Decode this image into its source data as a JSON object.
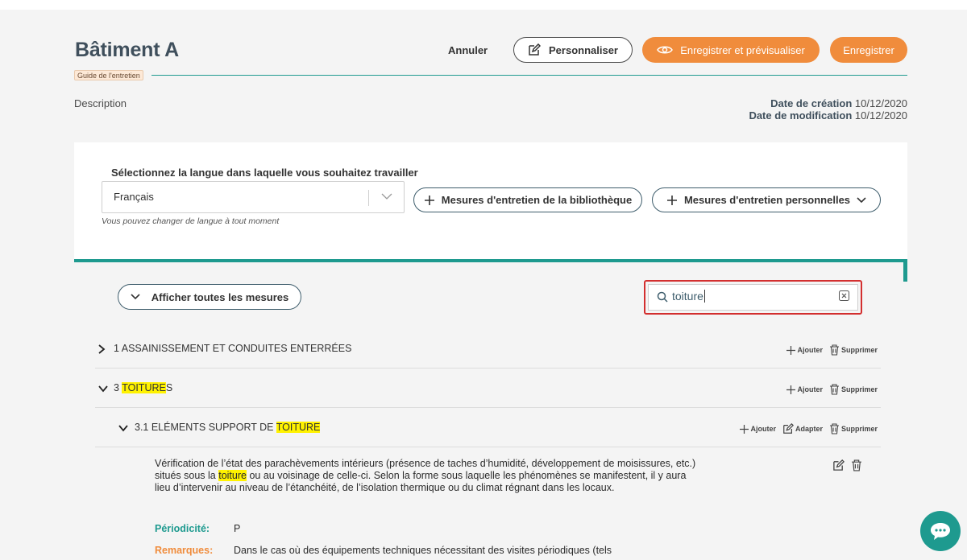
{
  "header": {
    "title": "Bâtiment A",
    "badge": "Guide de l'entretien",
    "description": "Description",
    "created_label": "Date de création",
    "created_value": "10/12/2020",
    "modified_label": "Date de modification",
    "modified_value": "10/12/2020"
  },
  "toolbar": {
    "cancel": "Annuler",
    "customize": "Personnaliser",
    "save_preview": "Enregistrer et prévisualiser",
    "save": "Enregistrer"
  },
  "language": {
    "label": "Sélectionnez la langue dans laquelle vous souhaitez travailler",
    "selected": "Français",
    "hint": "Vous pouvez changer de langue à tout moment"
  },
  "buttons": {
    "library": "Mesures d'entretien de la bibliothèque",
    "personal": "Mesures d'entretien personnelles",
    "show_all": "Afficher toutes les mesures"
  },
  "search": {
    "value": "toiture"
  },
  "actions": {
    "add": "Ajouter",
    "adapt": "Adapter",
    "delete": "Supprimer"
  },
  "rows": [
    {
      "label": "1 ASSAINISSEMENT ET CONDUITES ENTERRÉES"
    },
    {
      "prefix": "3 ",
      "highlight": "TOITURE",
      "suffix": "S"
    },
    {
      "prefix": "3.1 ELÉMENTS SUPPORT DE ",
      "highlight": "TOITURE",
      "suffix": ""
    }
  ],
  "detail": {
    "text_before": "Vérification de l’état des parachèvements intérieurs (présence de taches d’humidité, développement de moisissures, etc.) situés sous la ",
    "text_highlight": "toiture",
    "text_after": " ou au voisinage de celle-ci. Selon la forme sous laquelle les phénomènes se manifestent, il y aura lieu d’intervenir au niveau de l’étanchéité, de l’isolation thermique ou du climat régnant dans les locaux.",
    "periodicity_label": "Périodicité:",
    "periodicity_value": "P",
    "remarks_label": "Remarques:",
    "remarks_value": "Dans le cas où des équipements techniques nécessitant des visites périodiques (tels"
  },
  "colors": {
    "accent": "#1e9a8f",
    "orange": "#f08c3c",
    "highlight": "#fff200",
    "alert": "#d32f2f"
  }
}
